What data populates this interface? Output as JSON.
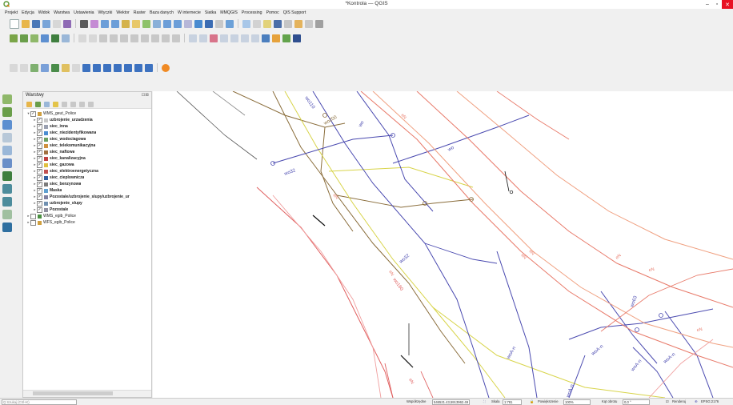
{
  "window": {
    "title": "*Kontrola — QGIS",
    "min_glyph": "–",
    "max_glyph": "▫",
    "close_glyph": "✕"
  },
  "menu": [
    "Projekt",
    "Edycja",
    "Widok",
    "Warstwa",
    "Ustawienia",
    "Wtyczki",
    "Wektor",
    "Raster",
    "Baza danych",
    "W internecie",
    "Siatka",
    "MMQGIS",
    "Processing",
    "Pomoc",
    "QIS Support"
  ],
  "layers_panel": {
    "title": "Warstwy",
    "close_glyph": "⊡⊠",
    "items": [
      {
        "name": "WMS_geut_Police",
        "indent": 0,
        "arrow": "▾",
        "checked": "✓",
        "bold": false
      },
      {
        "name": "uzbrojenie_urzadzenia",
        "indent": 1,
        "arrow": "▸",
        "checked": "✓",
        "bold": true
      },
      {
        "name": "siec_inna",
        "indent": 1,
        "arrow": "▸",
        "checked": "✓",
        "bold": true
      },
      {
        "name": "siec_niezidentyfikowana",
        "indent": 1,
        "arrow": "▸",
        "checked": "✓",
        "bold": true
      },
      {
        "name": "siec_wodociagowa",
        "indent": 1,
        "arrow": "▸",
        "checked": "✓",
        "bold": true
      },
      {
        "name": "siec_telekomunikacyjna",
        "indent": 1,
        "arrow": "▸",
        "checked": "✓",
        "bold": true
      },
      {
        "name": "siec_naftowa",
        "indent": 1,
        "arrow": "▸",
        "checked": "✓",
        "bold": true
      },
      {
        "name": "siec_kanalizacyjna",
        "indent": 1,
        "arrow": "▸",
        "checked": "✓",
        "bold": true
      },
      {
        "name": "siec_gazowa",
        "indent": 1,
        "arrow": "▸",
        "checked": "✓",
        "bold": true
      },
      {
        "name": "siec_elektroenergetyczna",
        "indent": 1,
        "arrow": "▸",
        "checked": "✓",
        "bold": true
      },
      {
        "name": "siec_cieplownicza",
        "indent": 1,
        "arrow": "▸",
        "checked": "✓",
        "bold": true
      },
      {
        "name": "siec_benzynowa",
        "indent": 1,
        "arrow": "▸",
        "checked": "✓",
        "bold": true
      },
      {
        "name": "Maska",
        "indent": 1,
        "arrow": "▸",
        "checked": "✓",
        "bold": true
      },
      {
        "name": "Pozostale/uzbrojenie_slupy/uzbrojenie_ur",
        "indent": 1,
        "arrow": "▸",
        "checked": "✓",
        "bold": true
      },
      {
        "name": "uzbrojenie_slupy",
        "indent": 1,
        "arrow": "▸",
        "checked": "✓",
        "bold": true
      },
      {
        "name": "Pozostale",
        "indent": 1,
        "arrow": "▸",
        "checked": "✓",
        "bold": true
      },
      {
        "name": "WMS_egib_Police",
        "indent": 0,
        "arrow": "▸",
        "checked": "",
        "bold": false
      },
      {
        "name": "WFS_egib_Police",
        "indent": 0,
        "arrow": "▸",
        "checked": "",
        "bold": false
      }
    ]
  },
  "map_labels": [
    "wo110",
    "wo200",
    "wo32",
    "wo",
    "wo",
    "eN",
    "eN",
    "eN",
    "eN",
    "eN",
    "eN",
    "eN",
    "wo32",
    "woA-n",
    "woA-n",
    "woA-n",
    "woA-n",
    "wo63",
    "woA-n",
    "eN",
    "wo160",
    "eN"
  ],
  "statusbar": {
    "search_placeholder": "Q  Szukaj (Ctrl+K)",
    "coord_label": "Współrzędne",
    "coord_value": "546521.43,5913962.49",
    "scale_label": "Skala",
    "scale_value": "1:781",
    "magnifier_label": "Powiększenie",
    "magnifier_value": "100%",
    "rotation_label": "Kąt obrotu",
    "rotation_value": "0,0 °",
    "render_label": "Renderuj",
    "crs": "EPSG:2176"
  }
}
